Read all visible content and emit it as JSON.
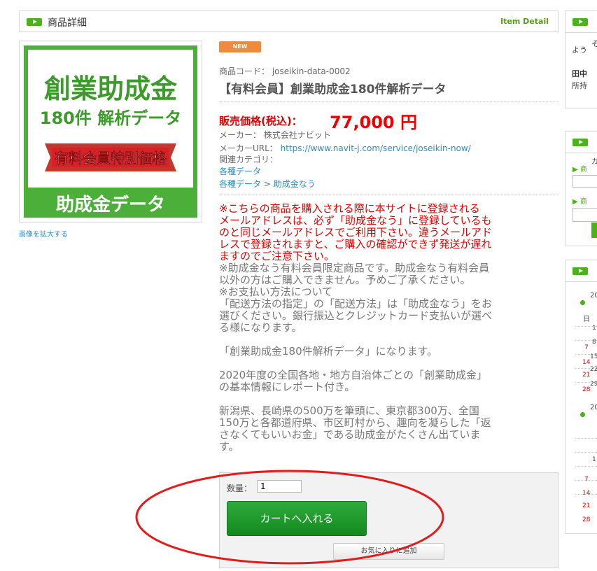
{
  "header": {
    "title": "商品詳細",
    "title_en": "Item Detail"
  },
  "product": {
    "image_texts": {
      "line1": "創業助成金",
      "line2": "180件 解析データ",
      "band": "有料会員特別価格",
      "footer": "助成金データ"
    },
    "enlarge_link": "画像を拡大する",
    "badge": "NEW",
    "code_label": "商品コード：",
    "code": "joseikin-data-0002",
    "name": "【有料会員】創業助成金180件解析データ",
    "price_label": "販売価格(税込)：",
    "price": "77,000 円",
    "maker_label": "メーカー：",
    "maker": "株式会社ナビット",
    "maker_url_label": "メーカーURL：",
    "maker_url": "https://www.navit-j.com/service/joseikin-now/",
    "category_label": "関連カテゴリ：",
    "category1": "各種データ",
    "category2_parent": "各種データ",
    "category2_sep": ">",
    "category2_child": "助成金なう"
  },
  "description": {
    "red": [
      "※こちらの商品を購入される際に本サイトに登録される",
      "メールアドレスは、必ず「助成金なう」に登録しているも",
      "のと同じメールアドレスでご利用下さい。違うメールアド",
      "レスで登録されますと、ご購入の確認ができず発送が遅れ",
      "ますのでご注意下さい。"
    ],
    "gray1": [
      "※助成金なう有料会員限定商品です。助成金なう有料会員",
      "以外の方はご購入できません。予めご了承ください。",
      "※お支払い方法について",
      "「配送方法の指定」の「配送方法」は「助成金なう」をお",
      "選びください。銀行振込とクレジットカード支払いが選べ",
      "る様になります。"
    ],
    "gray2": "「創業助成金180件解析データ」になります。",
    "gray3": [
      "2020年度の全国各地・地方自治体ごとの「創業助成金」",
      "の基本情報にレポート付き。"
    ],
    "gray4": [
      "新潟県、長崎県の500万を筆頭に、東京都300万、全国",
      "150万と各都道府県、市区町村から、趣向を凝らした「返",
      "さなくてもいいお金」である助成金がたくさん出ていま",
      "す。"
    ]
  },
  "cart": {
    "qty_label": "数量：",
    "qty_value": "1",
    "add_button": "カートへ入れる",
    "fav_button": "お気に入りに追加"
  },
  "sidebar": {
    "welcome_fragment": "よう",
    "welcome_fragment2": "そ",
    "user_fragment": "田中",
    "points_fragment": "所持",
    "search_fragment1": "カ",
    "search_item1": "▶ 商",
    "search_item2": "▶ 商",
    "calendar_months": [
      "20",
      "20"
    ],
    "calendar_day_fragment": "日",
    "calendar_rows": [
      "1",
      "8",
      "15",
      "22",
      "29"
    ],
    "calendar_red": [
      "7",
      "14",
      "21",
      "28"
    ]
  },
  "colors": {
    "accent_green": "#4ab31c",
    "price_red": "#e00",
    "link_blue": "#2a8fc7",
    "annotation_red": "#e41b1b"
  }
}
